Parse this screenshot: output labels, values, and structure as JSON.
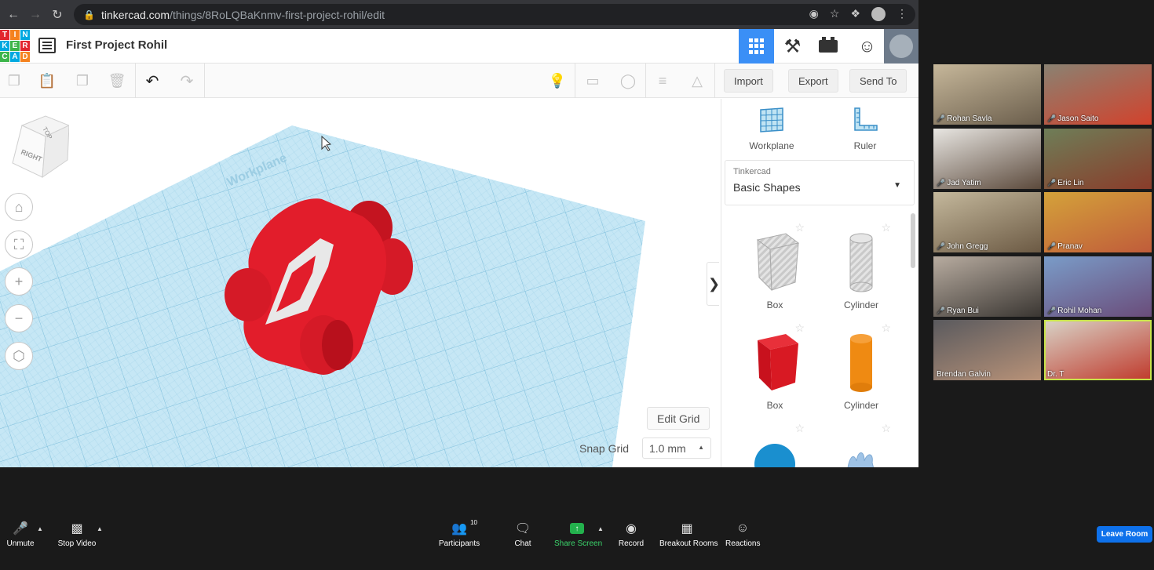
{
  "browser": {
    "url_host": "tinkercad.com",
    "url_path": "/things/8RoLQBaKnmv-first-project-rohil/edit"
  },
  "logo": [
    "T",
    "I",
    "N",
    "K",
    "E",
    "R",
    "C",
    "A",
    "D"
  ],
  "header": {
    "project_title": "First Project Rohil"
  },
  "toolbar": {
    "import_label": "Import",
    "export_label": "Export",
    "send_to_label": "Send To"
  },
  "workspace": {
    "view_cube_top": "TOP",
    "view_cube_right": "RIGHT",
    "workplane_label": "Workplane",
    "edit_grid_label": "Edit Grid",
    "snap_grid_label": "Snap Grid",
    "snap_grid_value": "1.0 mm"
  },
  "panel": {
    "workplane_label": "Workplane",
    "ruler_label": "Ruler",
    "library_small": "Tinkercad",
    "library_name": "Basic Shapes",
    "shapes": [
      {
        "label": "Box"
      },
      {
        "label": "Cylinder"
      },
      {
        "label": "Box"
      },
      {
        "label": "Cylinder"
      }
    ]
  },
  "participants": [
    {
      "name": "Rohan Savla"
    },
    {
      "name": "Jason Saito"
    },
    {
      "name": "Jad Yatim"
    },
    {
      "name": "Eric Lin"
    },
    {
      "name": "John Gregg"
    },
    {
      "name": "Pranav"
    },
    {
      "name": "Ryan Bui"
    },
    {
      "name": "Rohil Mohan"
    },
    {
      "name": "Brendan Galvin"
    },
    {
      "name": "Dr. T"
    }
  ],
  "zoom": {
    "unmute": "Unmute",
    "stop_video": "Stop Video",
    "participants": "Participants",
    "participant_count": "10",
    "chat": "Chat",
    "share_screen": "Share Screen",
    "record": "Record",
    "breakout_rooms": "Breakout Rooms",
    "reactions": "Reactions",
    "leave_room": "Leave Room"
  },
  "colors": {
    "accent_blue": "#3a8ff6",
    "car_red": "#e21d2b",
    "grid_blue": "#bfe3f3",
    "share_green": "#23b14d",
    "leave_blue": "#0e71eb"
  }
}
